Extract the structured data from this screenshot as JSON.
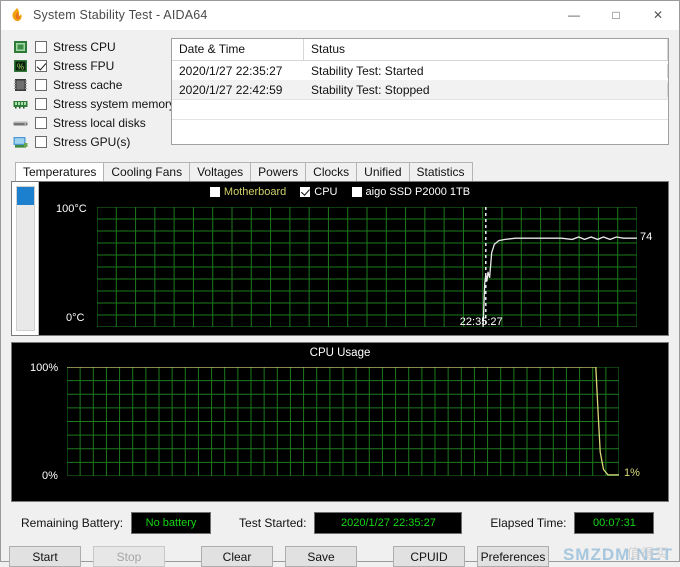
{
  "window": {
    "title": "System Stability Test - AIDA64",
    "app_icon": "flame-icon",
    "controls": {
      "minimize": "—",
      "maximize": "□",
      "close": "✕"
    }
  },
  "stress_options": [
    {
      "label": "Stress CPU",
      "checked": false,
      "icon": "cpu-icon"
    },
    {
      "label": "Stress FPU",
      "checked": true,
      "icon": "fpu-icon"
    },
    {
      "label": "Stress cache",
      "checked": false,
      "icon": "cache-icon"
    },
    {
      "label": "Stress system memory",
      "checked": false,
      "icon": "memory-icon"
    },
    {
      "label": "Stress local disks",
      "checked": false,
      "icon": "disk-icon"
    },
    {
      "label": "Stress GPU(s)",
      "checked": false,
      "icon": "gpu-icon"
    }
  ],
  "log": {
    "columns": [
      "Date & Time",
      "Status"
    ],
    "rows": [
      {
        "datetime": "2020/1/27 22:35:27",
        "status": "Stability Test: Started"
      },
      {
        "datetime": "2020/1/27 22:42:59",
        "status": "Stability Test: Stopped"
      }
    ]
  },
  "tabs": [
    {
      "label": "Temperatures",
      "active": true
    },
    {
      "label": "Cooling Fans",
      "active": false
    },
    {
      "label": "Voltages",
      "active": false
    },
    {
      "label": "Powers",
      "active": false
    },
    {
      "label": "Clocks",
      "active": false
    },
    {
      "label": "Unified",
      "active": false
    },
    {
      "label": "Statistics",
      "active": false
    }
  ],
  "legend": [
    {
      "label": "Motherboard",
      "checked": false,
      "color": "#cfcf6a"
    },
    {
      "label": "CPU",
      "checked": true,
      "color": "#ffffff"
    },
    {
      "label": "aigo SSD P2000 1TB",
      "checked": false,
      "color": "#ffffff"
    }
  ],
  "status": {
    "battery_label": "Remaining Battery:",
    "battery_value": "No battery",
    "start_label": "Test Started:",
    "start_value": "2020/1/27 22:35:27",
    "elapsed_label": "Elapsed Time:",
    "elapsed_value": "00:07:31"
  },
  "buttons": [
    {
      "label": "Start",
      "disabled": false
    },
    {
      "label": "Stop",
      "disabled": true
    },
    {
      "label": "Clear",
      "disabled": false
    },
    {
      "label": "Save",
      "disabled": false
    },
    {
      "label": "CPUID",
      "disabled": false
    },
    {
      "label": "Preferences",
      "disabled": false
    }
  ],
  "watermark": {
    "text": "SMZDM.NET",
    "sub": "值得买"
  },
  "chart_data": [
    {
      "type": "line",
      "title": "",
      "name": "temperature-chart",
      "ylabel_top": "100°C",
      "ylabel_bottom": "0°C",
      "ylim": [
        0,
        100
      ],
      "xlabel_marker": "22:35:27",
      "marker_x_fraction": 0.72,
      "grid": true,
      "grid_color": "#1d7a1d",
      "bg": "#000000",
      "series": [
        {
          "name": "CPU",
          "color": "#e8e8e8",
          "end_value": 74,
          "end_label": "74",
          "points": [
            [
              0.715,
              0
            ],
            [
              0.718,
              36
            ],
            [
              0.72,
              44
            ],
            [
              0.722,
              38
            ],
            [
              0.724,
              46
            ],
            [
              0.727,
              41
            ],
            [
              0.731,
              62
            ],
            [
              0.736,
              69
            ],
            [
              0.744,
              72
            ],
            [
              0.756,
              73
            ],
            [
              0.775,
              74
            ],
            [
              0.8,
              74
            ],
            [
              0.83,
              74
            ],
            [
              0.86,
              74
            ],
            [
              0.88,
              73
            ],
            [
              0.892,
              75
            ],
            [
              0.903,
              73
            ],
            [
              0.915,
              75
            ],
            [
              0.927,
              73
            ],
            [
              0.938,
              75
            ],
            [
              0.95,
              73
            ],
            [
              0.962,
              75
            ],
            [
              0.975,
              74
            ],
            [
              0.99,
              74
            ],
            [
              1.0,
              74
            ]
          ]
        }
      ]
    },
    {
      "type": "line",
      "title": "CPU Usage",
      "name": "cpu-usage-chart",
      "ylabel_top": "100%",
      "ylabel_bottom": "0%",
      "ylim": [
        0,
        100
      ],
      "grid": true,
      "grid_color": "#1d7a1d",
      "bg": "#000000",
      "series": [
        {
          "name": "CPU Usage",
          "color": "#d9d97a",
          "end_value": 1,
          "end_label": "1%",
          "points": [
            [
              0.0,
              100
            ],
            [
              0.2,
              100
            ],
            [
              0.4,
              100
            ],
            [
              0.6,
              100
            ],
            [
              0.8,
              100
            ],
            [
              0.93,
              100
            ],
            [
              0.958,
              100
            ],
            [
              0.962,
              60
            ],
            [
              0.966,
              22
            ],
            [
              0.972,
              6
            ],
            [
              0.98,
              1
            ],
            [
              1.0,
              1
            ]
          ]
        }
      ]
    }
  ]
}
